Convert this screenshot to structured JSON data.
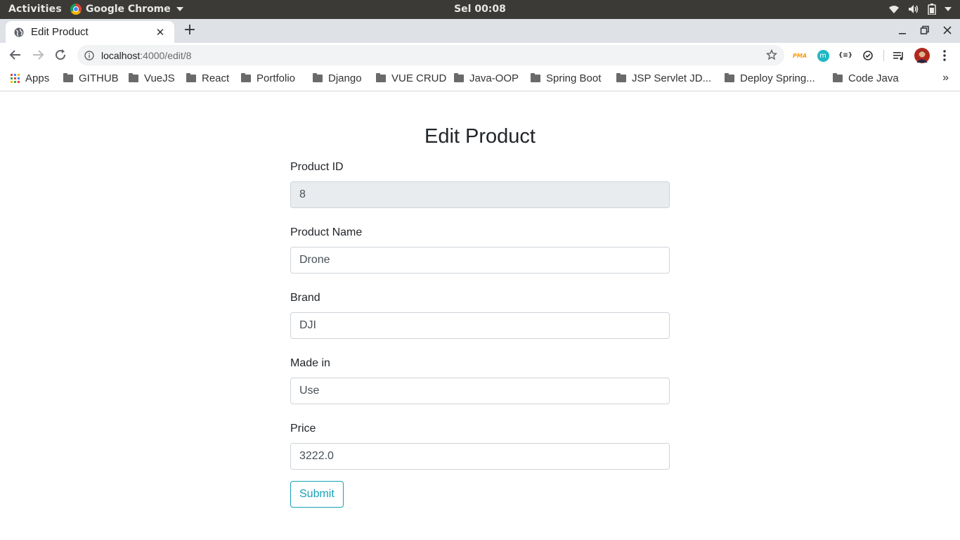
{
  "system_bar": {
    "activities": "Activities",
    "app_name": "Google Chrome",
    "clock": "Sel 00:08"
  },
  "browser": {
    "tab_title": "Edit Product",
    "url_host": "localhost",
    "url_path": ":4000/edit/8",
    "bookmarks": [
      {
        "label": "Apps",
        "icon": "apps-grid-icon"
      },
      {
        "label": "GITHUB",
        "icon": "folder-icon"
      },
      {
        "label": "VueJS",
        "icon": "folder-icon"
      },
      {
        "label": "React",
        "icon": "folder-icon"
      },
      {
        "label": "Portfolio",
        "icon": "folder-icon"
      },
      {
        "label": "Django",
        "icon": "folder-icon"
      },
      {
        "label": "VUE CRUD",
        "icon": "folder-icon"
      },
      {
        "label": "Java-OOP",
        "icon": "folder-icon"
      },
      {
        "label": "Spring Boot",
        "icon": "folder-icon"
      },
      {
        "label": "JSP Servlet JD...",
        "icon": "folder-icon"
      },
      {
        "label": "Deploy Spring...",
        "icon": "folder-icon"
      },
      {
        "label": "Code Java",
        "icon": "folder-icon"
      }
    ],
    "overflow_label": "»",
    "extensions": [
      {
        "name": "phpmyadmin-extension-icon",
        "text": "PMA",
        "color": "#f89c0e"
      },
      {
        "name": "mercury-extension-icon",
        "text": "m",
        "color": "#1fb8c3"
      },
      {
        "name": "json-viewer-extension-icon",
        "text": "{≡}",
        "color": "#333333"
      }
    ]
  },
  "page": {
    "title": "Edit Product",
    "fields": {
      "product_id": {
        "label": "Product ID",
        "value": "8"
      },
      "product_name": {
        "label": "Product Name",
        "value": "Drone"
      },
      "brand": {
        "label": "Brand",
        "value": "DJI"
      },
      "made_in": {
        "label": "Made in",
        "value": "Use"
      },
      "price": {
        "label": "Price",
        "value": "3222.0"
      }
    },
    "submit_label": "Submit",
    "accent_color": "#17a2b8"
  }
}
